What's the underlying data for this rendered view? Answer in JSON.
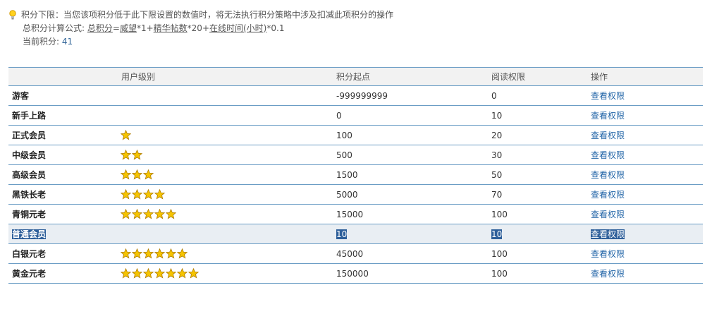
{
  "notice": {
    "line1": "积分下限：当您该项积分低于此下限设置的数值时，将无法执行积分策略中涉及扣减此项积分的操作",
    "formula_label": "总积分计算公式: ",
    "formula_total": "总积分",
    "formula_eq": "=",
    "formula_weiwang": "威望",
    "formula_mid1": "*1+",
    "formula_digest": "精华帖数",
    "formula_mid2": "*20+",
    "formula_online": "在线时间(小时)",
    "formula_end": "*0.1",
    "current_label": "当前积分: ",
    "current_value": "41"
  },
  "table": {
    "headers": {
      "level": "用户级别",
      "start": "积分起点",
      "read": "阅读权限",
      "action": "操作"
    },
    "rows": [
      {
        "name": "游客",
        "stars": 0,
        "start": "-999999999",
        "read": "0",
        "action": "查看权限"
      },
      {
        "name": "新手上路",
        "stars": 0,
        "start": "0",
        "read": "10",
        "action": "查看权限"
      },
      {
        "name": "正式会员",
        "stars": 1,
        "start": "100",
        "read": "20",
        "action": "查看权限"
      },
      {
        "name": "中级会员",
        "stars": 2,
        "start": "500",
        "read": "30",
        "action": "查看权限"
      },
      {
        "name": "高级会员",
        "stars": 3,
        "start": "1500",
        "read": "50",
        "action": "查看权限"
      },
      {
        "name": "黑铁长老",
        "stars": 4,
        "start": "5000",
        "read": "70",
        "action": "查看权限"
      },
      {
        "name": "青铜元老",
        "stars": 5,
        "start": "15000",
        "read": "100",
        "action": "查看权限"
      },
      {
        "name": "普通会员",
        "stars": 0,
        "start": "10",
        "read": "10",
        "action": "查看权限",
        "selected": true
      },
      {
        "name": "白银元老",
        "stars": 6,
        "start": "45000",
        "read": "100",
        "action": "查看权限"
      },
      {
        "name": "黄金元老",
        "stars": 7,
        "start": "150000",
        "read": "100",
        "action": "查看权限"
      }
    ]
  },
  "colors": {
    "accent_line": "#6b9dc5",
    "link": "#2366a8",
    "selection": "#2e5f9a",
    "star_fill": "#f5c400"
  },
  "icons": {
    "notice": "lightbulb-icon",
    "level": "star-icon"
  }
}
